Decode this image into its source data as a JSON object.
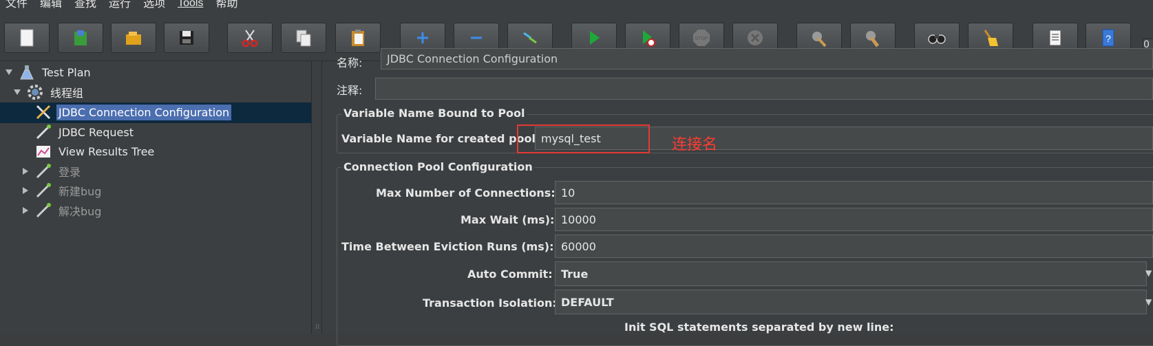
{
  "menubar": {
    "items": [
      "文件",
      "编辑",
      "查找",
      "运行",
      "选项",
      "Tools",
      "帮助"
    ]
  },
  "toolbar": {
    "buttons": [
      {
        "name": "new-icon"
      },
      {
        "name": "templates-icon"
      },
      {
        "name": "open-icon"
      },
      {
        "name": "save-icon"
      },
      {
        "name": "cut-icon"
      },
      {
        "name": "copy-icon"
      },
      {
        "name": "paste-icon"
      },
      {
        "name": "expand-all-icon"
      },
      {
        "name": "collapse-all-icon"
      },
      {
        "name": "toggle-icon"
      },
      {
        "name": "start-icon"
      },
      {
        "name": "start-no-pauses-icon"
      },
      {
        "name": "stop-icon"
      },
      {
        "name": "shutdown-icon"
      },
      {
        "name": "clear-icon"
      },
      {
        "name": "clear-all-icon"
      },
      {
        "name": "search-icon"
      },
      {
        "name": "reset-search-icon"
      },
      {
        "name": "function-helper-icon"
      },
      {
        "name": "help-icon"
      }
    ],
    "edge_text": "0"
  },
  "tree": {
    "nodes": [
      {
        "label": "Test Plan",
        "icon": "flask-icon"
      },
      {
        "label": "线程组",
        "icon": "gear-icon"
      },
      {
        "label": "JDBC Connection Configuration",
        "icon": "wrench-screwdriver-icon"
      },
      {
        "label": "JDBC Request",
        "icon": "pipette-icon"
      },
      {
        "label": "View Results Tree",
        "icon": "chart-icon"
      },
      {
        "label": "登录",
        "icon": "pipette-icon"
      },
      {
        "label": "新建bug",
        "icon": "pipette-icon"
      },
      {
        "label": "解决bug",
        "icon": "pipette-icon"
      }
    ]
  },
  "form": {
    "name_label": "名称:",
    "name_value": "JDBC Connection Configuration",
    "comment_label": "注释:",
    "comment_value": "",
    "var_group_title": "Variable Name Bound to Pool",
    "var_label": "Variable Name for created pool:",
    "var_value": "mysql_test",
    "annotation": "连接名",
    "pool_group_title": "Connection Pool Configuration",
    "max_conn_label": "Max Number of Connections:",
    "max_conn_value": "10",
    "max_wait_label": "Max Wait (ms):",
    "max_wait_value": "10000",
    "eviction_label": "Time Between Eviction Runs (ms):",
    "eviction_value": "60000",
    "auto_commit_label": "Auto Commit:",
    "auto_commit_value": "True",
    "isolation_label": "Transaction Isolation:",
    "isolation_value": "DEFAULT",
    "init_sql_label": "Init SQL statements separated by new line:"
  },
  "colors": {
    "selection": "#4b6eaf",
    "annotation_red": "#e53935"
  }
}
